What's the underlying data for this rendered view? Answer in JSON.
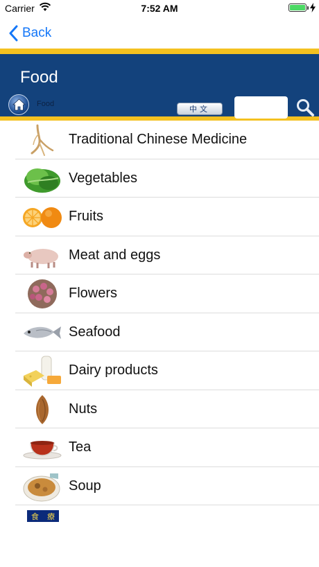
{
  "status": {
    "carrier": "Carrier",
    "time": "7:52 AM"
  },
  "nav": {
    "back_label": "Back"
  },
  "header": {
    "title": "Food",
    "breadcrumb": "Food",
    "lang_button": "中文",
    "search_value": ""
  },
  "colors": {
    "header_bg": "#13427c",
    "accent_gold": "#f4c120",
    "link_blue": "#1477f8"
  },
  "categories": [
    {
      "label": "Traditional Chinese Medicine",
      "icon": "ginseng-root-icon"
    },
    {
      "label": "Vegetables",
      "icon": "lettuce-icon"
    },
    {
      "label": "Fruits",
      "icon": "orange-icon"
    },
    {
      "label": "Meat and eggs",
      "icon": "pig-icon"
    },
    {
      "label": "Flowers",
      "icon": "rosebuds-icon"
    },
    {
      "label": "Seafood",
      "icon": "fish-icon"
    },
    {
      "label": "Dairy products",
      "icon": "dairy-icon"
    },
    {
      "label": "Nuts",
      "icon": "almond-icon"
    },
    {
      "label": "Tea",
      "icon": "tea-cup-icon"
    },
    {
      "label": "Soup",
      "icon": "soup-bowl-icon"
    }
  ],
  "footer_logo": {
    "chars": [
      "食",
      "療"
    ]
  }
}
